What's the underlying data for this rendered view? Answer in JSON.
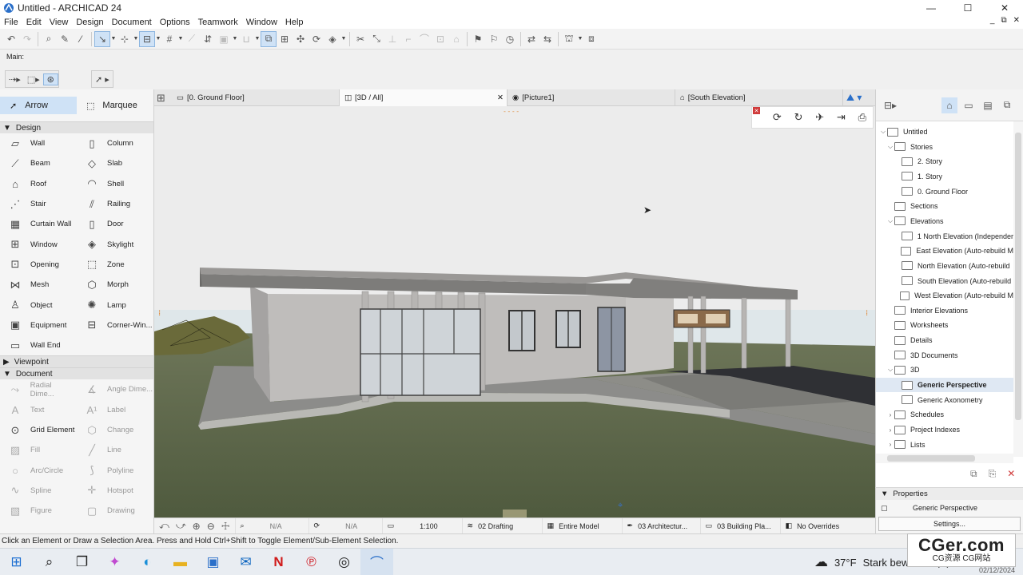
{
  "window": {
    "title": "Untitled - ARCHICAD 24",
    "minimize": "—",
    "maximize": "☐",
    "close": "✕"
  },
  "menu": [
    "File",
    "Edit",
    "View",
    "Design",
    "Document",
    "Options",
    "Teamwork",
    "Window",
    "Help"
  ],
  "menu_right": {
    "minimize": "_",
    "restore": "⧉",
    "close": "✕"
  },
  "infobox": {
    "label": "Main:"
  },
  "toolbox": {
    "arrow": "Arrow",
    "marquee": "Marquee",
    "design_section": "Design",
    "design_tools": [
      [
        "Wall",
        "Column"
      ],
      [
        "Beam",
        "Slab"
      ],
      [
        "Roof",
        "Shell"
      ],
      [
        "Stair",
        "Railing"
      ],
      [
        "Curtain Wall",
        "Door"
      ],
      [
        "Window",
        "Skylight"
      ],
      [
        "Opening",
        "Zone"
      ],
      [
        "Mesh",
        "Morph"
      ],
      [
        "Object",
        "Lamp"
      ],
      [
        "Equipment",
        "Corner-Win..."
      ],
      [
        "Wall End",
        ""
      ]
    ],
    "viewpoint_section": "Viewpoint",
    "document_section": "Document",
    "document_tools": [
      [
        "Radial Dime...",
        "Angle Dime..."
      ],
      [
        "Text",
        "Label"
      ],
      [
        "Grid Element",
        "Change"
      ],
      [
        "Fill",
        "Line"
      ],
      [
        "Arc/Circle",
        "Polyline"
      ],
      [
        "Spline",
        "Hotspot"
      ],
      [
        "Figure",
        "Drawing"
      ]
    ]
  },
  "tabs": [
    {
      "label": "[0. Ground Floor]"
    },
    {
      "label": "[3D / All]",
      "close": "✕"
    },
    {
      "label": "[Picture1]"
    },
    {
      "label": "[South Elevation]"
    }
  ],
  "viewport_bar": {
    "zoom_na": "N/A",
    "angle_na": "N/A",
    "scale": "1:100",
    "layer": "02 Drafting",
    "model": "Entire Model",
    "pen": "03 Architectur...",
    "mvo": "03 Building Pla...",
    "overrides": "No Overrides"
  },
  "navigator": {
    "items": [
      {
        "label": "Untitled",
        "level": 0,
        "tw": "⌵"
      },
      {
        "label": "Stories",
        "level": 1,
        "tw": "⌵"
      },
      {
        "label": "2. Story",
        "level": 2,
        "tw": ""
      },
      {
        "label": "1. Story",
        "level": 2,
        "tw": ""
      },
      {
        "label": "0. Ground Floor",
        "level": 2,
        "tw": ""
      },
      {
        "label": "Sections",
        "level": 1,
        "tw": ""
      },
      {
        "label": "Elevations",
        "level": 1,
        "tw": "⌵"
      },
      {
        "label": "1 North Elevation (Independer",
        "level": 2,
        "tw": ""
      },
      {
        "label": "East Elevation (Auto-rebuild M",
        "level": 2,
        "tw": ""
      },
      {
        "label": "North Elevation (Auto-rebuild",
        "level": 2,
        "tw": ""
      },
      {
        "label": "South Elevation (Auto-rebuild",
        "level": 2,
        "tw": ""
      },
      {
        "label": "West Elevation (Auto-rebuild M",
        "level": 2,
        "tw": ""
      },
      {
        "label": "Interior Elevations",
        "level": 1,
        "tw": ""
      },
      {
        "label": "Worksheets",
        "level": 1,
        "tw": ""
      },
      {
        "label": "Details",
        "level": 1,
        "tw": ""
      },
      {
        "label": "3D Documents",
        "level": 1,
        "tw": ""
      },
      {
        "label": "3D",
        "level": 1,
        "tw": "⌵"
      },
      {
        "label": "Generic Perspective",
        "level": 2,
        "tw": "",
        "selected": true
      },
      {
        "label": "Generic Axonometry",
        "level": 2,
        "tw": ""
      },
      {
        "label": "Schedules",
        "level": 1,
        "tw": "›"
      },
      {
        "label": "Project Indexes",
        "level": 1,
        "tw": "›"
      },
      {
        "label": "Lists",
        "level": 1,
        "tw": "›"
      }
    ]
  },
  "properties": {
    "header": "Properties",
    "name": "Generic Perspective",
    "settings": "Settings..."
  },
  "status": "Click an Element or Draw a Selection Area. Press and Hold Ctrl+Shift to Toggle Element/Sub-Element Selection.",
  "taskbar": {
    "weather_temp": "37°F",
    "weather_text": "Stark bewölkt",
    "date": "02/12/2024"
  },
  "watermark": {
    "brand": "CGer.com",
    "sub": "CG资源 CG网站"
  },
  "colors": {
    "selection": "#cfe2f6",
    "accent": "#2a6fc9",
    "grass": "#5d6748"
  }
}
